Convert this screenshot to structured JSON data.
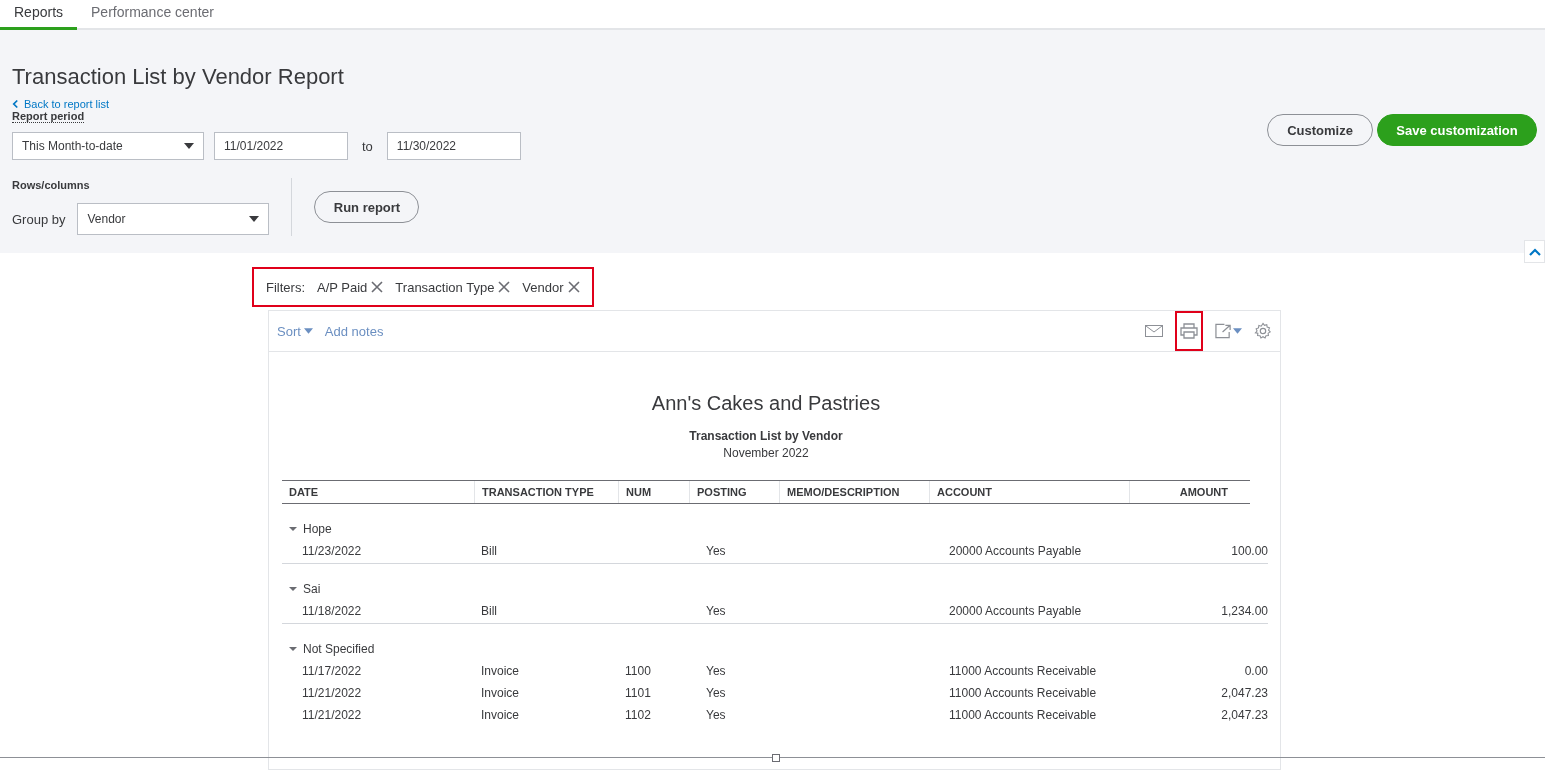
{
  "tabs": [
    {
      "label": "Reports",
      "selected": true
    },
    {
      "label": "Performance center",
      "selected": false
    }
  ],
  "header": {
    "title": "Transaction List by Vendor Report",
    "back_link": "Back to report list",
    "period_label": "Report period",
    "period_select": "This Month-to-date",
    "from_date": "11/01/2022",
    "to_label": "to",
    "to_date": "11/30/2022",
    "rows_columns_label": "Rows/columns",
    "group_by_label": "Group by",
    "group_by_select": "Vendor",
    "run_button": "Run report",
    "customize_button": "Customize",
    "save_button": "Save customization"
  },
  "filters": {
    "label": "Filters:",
    "highlighted": true,
    "items": [
      "A/P Paid",
      "Transaction Type",
      "Vendor"
    ]
  },
  "toolbar": {
    "sort": "Sort",
    "add_notes": "Add notes",
    "print_highlighted": true
  },
  "report": {
    "company": "Ann's Cakes and Pastries",
    "title": "Transaction List by Vendor",
    "period": "November 2022",
    "columns": [
      "DATE",
      "TRANSACTION TYPE",
      "NUM",
      "POSTING",
      "MEMO/DESCRIPTION",
      "ACCOUNT",
      "AMOUNT"
    ],
    "groups": [
      {
        "name": "Hope",
        "expanded": true,
        "rows": [
          [
            "11/23/2022",
            "Bill",
            "",
            "Yes",
            "",
            "20000 Accounts Payable",
            "100.00"
          ]
        ]
      },
      {
        "name": "Sai",
        "expanded": true,
        "rows": [
          [
            "11/18/2022",
            "Bill",
            "",
            "Yes",
            "",
            "20000 Accounts Payable",
            "1,234.00"
          ]
        ]
      },
      {
        "name": "Not Specified",
        "expanded": true,
        "rows": [
          [
            "11/17/2022",
            "Invoice",
            "1100",
            "Yes",
            "",
            "11000 Accounts Receivable",
            "0.00"
          ],
          [
            "11/21/2022",
            "Invoice",
            "1101",
            "Yes",
            "",
            "11000 Accounts Receivable",
            "2,047.23"
          ],
          [
            "11/21/2022",
            "Invoice",
            "1102",
            "Yes",
            "",
            "11000 Accounts Receivable",
            "2,047.23"
          ]
        ]
      }
    ]
  }
}
